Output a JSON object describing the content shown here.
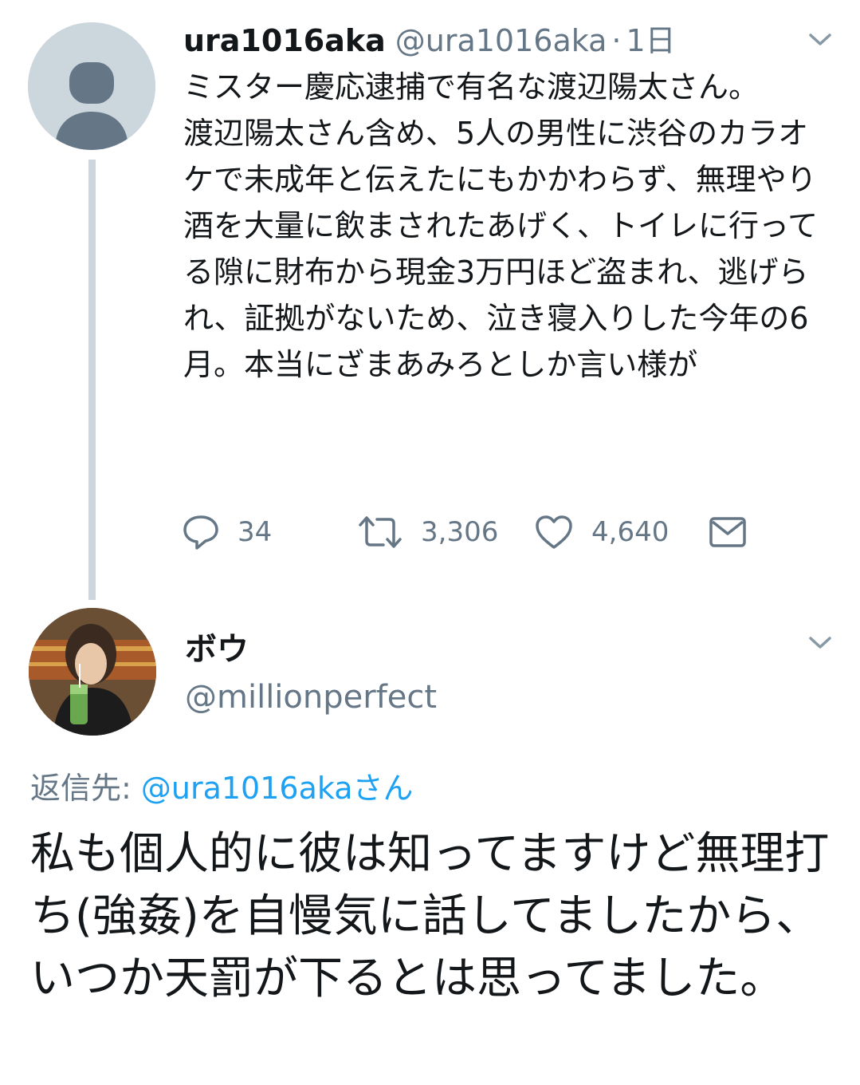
{
  "original_tweet": {
    "display_name": "ura1016aka",
    "handle": "@ura1016aka",
    "separator": "·",
    "time": "1日",
    "body": "ミスター慶応逮捕で有名な渡辺陽太さん。\n渡辺陽太さん含め、5人の男性に渋谷のカラオケで未成年と伝えたにもかかわらず、無理やり酒を大量に飲まされたあげく、トイレに行ってる隙に財布から現金3万円ほど盗まれ、逃げられ、証拠がないため、泣き寝入りした今年の6月。本当にざまあみろとしか言い様が",
    "actions": {
      "replies": "34",
      "retweets": "3,306",
      "likes": "4,640"
    }
  },
  "reply_tweet": {
    "display_name": "ボウ",
    "handle": "@millionperfect",
    "reply_to_label": "返信先: ",
    "reply_to_handle": "@ura1016akaさん",
    "body": "私も個人的に彼は知ってますけど無理打ち(強姦)を自慢気に話してましたから、いつか天罰が下るとは思ってました。"
  },
  "colors": {
    "primary_text": "#14171a",
    "secondary_text": "#657786",
    "link": "#1da1f2",
    "thread_line": "#ccd6dd"
  },
  "icons": [
    "default-avatar-icon",
    "chevron-down-icon",
    "reply-icon",
    "retweet-icon",
    "like-icon",
    "direct-message-icon"
  ]
}
